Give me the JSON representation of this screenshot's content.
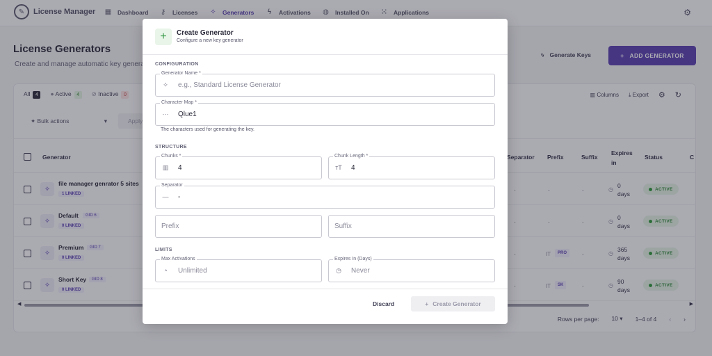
{
  "app": {
    "name": "License Manager"
  },
  "nav": {
    "items": [
      {
        "label": "Dashboard",
        "icon": "dashboard-icon"
      },
      {
        "label": "Licenses",
        "icon": "key-icon"
      },
      {
        "label": "Generators",
        "icon": "generator-icon",
        "active": true
      },
      {
        "label": "Activations",
        "icon": "bolt-icon"
      },
      {
        "label": "Installed On",
        "icon": "globe-icon"
      },
      {
        "label": "Applications",
        "icon": "grid-icon"
      }
    ]
  },
  "page": {
    "title": "License Generators",
    "subtitle": "Create and manage automatic key generat",
    "generate_keys_label": "Generate Keys",
    "add_generator_label": "ADD GENERATOR"
  },
  "filters": {
    "all_label": "All",
    "all_count": "4",
    "active_label": "Active",
    "active_count": "4",
    "inactive_label": "Inactive",
    "inactive_count": "0"
  },
  "toolbar": {
    "columns_label": "Columns",
    "export_label": "Export"
  },
  "bulk": {
    "label": "Bulk actions",
    "apply_label": "Apply"
  },
  "table": {
    "headers": {
      "generator": "Generator",
      "separator": "Separator",
      "prefix": "Prefix",
      "suffix": "Suffix",
      "expires": "Expires in",
      "status": "Status",
      "c": "C"
    },
    "rows": [
      {
        "name": "file manager genrator 5 sites",
        "linked": "1 LINKED",
        "gid": "",
        "separator": "-",
        "prefix_lead": "-",
        "prefix": "",
        "suffix": "-",
        "expires_num": "0",
        "expires_unit": "days",
        "status": "ACTIVE"
      },
      {
        "name": "Default",
        "linked": "0 LINKED",
        "gid": "GID 6",
        "separator": "-",
        "prefix_lead": "-",
        "prefix": "",
        "suffix": "-",
        "expires_num": "0",
        "expires_unit": "days",
        "status": "ACTIVE"
      },
      {
        "name": "Premium",
        "linked": "0 LINKED",
        "gid": "GID 7",
        "separator": "-",
        "prefix_lead": "IT",
        "prefix": "PRO",
        "suffix": "-",
        "expires_num": "365",
        "expires_unit": "days",
        "status": "ACTIVE"
      },
      {
        "name": "Short Key",
        "linked": "0 LINKED",
        "gid": "GID 8",
        "separator": "-",
        "prefix_lead": "IT",
        "prefix": "SK",
        "suffix": "-",
        "expires_num": "90",
        "expires_unit": "days",
        "status": "ACTIVE"
      }
    ]
  },
  "pagination": {
    "rows_per_page_label": "Rows per page:",
    "rows_per_page": "10",
    "range": "1–4 of 4"
  },
  "modal": {
    "title": "Create Generator",
    "subtitle": "Configure a new key generator",
    "sections": {
      "configuration": "CONFIGURATION",
      "structure": "STRUCTURE",
      "limits": "LIMITS"
    },
    "fields": {
      "generator_name": {
        "label": "Generator Name *",
        "value": "",
        "placeholder": "e.g., Standard License Generator"
      },
      "character_map": {
        "label": "Character Map *",
        "value": "Qlue1",
        "helper": "The characters used for generating the key."
      },
      "chunks": {
        "label": "Chunks *",
        "value": "4"
      },
      "chunk_length": {
        "label": "Chunk Length *",
        "value": "4"
      },
      "separator": {
        "label": "Separator",
        "value": "-"
      },
      "prefix": {
        "placeholder": "Prefix",
        "value": ""
      },
      "suffix": {
        "placeholder": "Suffix",
        "value": ""
      },
      "max_activations": {
        "label": "Max Activations",
        "placeholder": "Unlimited",
        "value": ""
      },
      "expires_in": {
        "label": "Expires In (Days)",
        "placeholder": "Never",
        "value": ""
      }
    },
    "discard_label": "Discard",
    "create_label": "Create Generator"
  },
  "colors": {
    "accent": "#5a3fb0",
    "active_green": "#2f8a3a"
  }
}
